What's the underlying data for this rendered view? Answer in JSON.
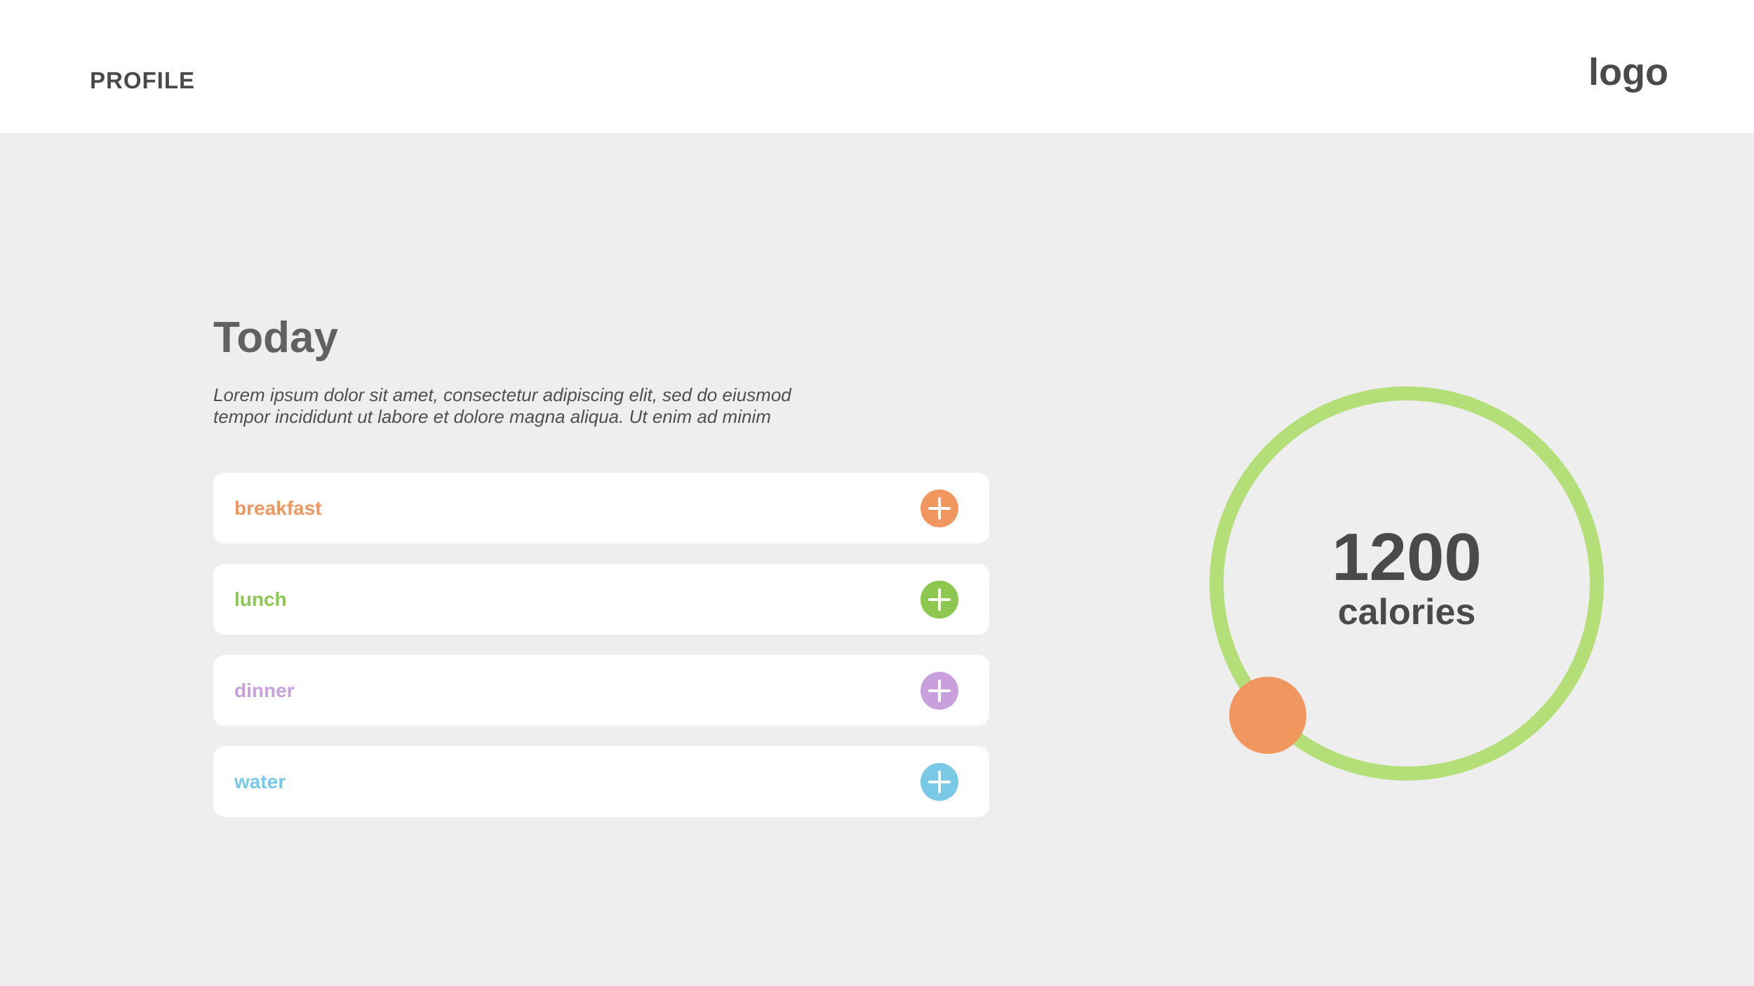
{
  "header": {
    "profile_label": "PROFILE",
    "logo_text": "logo"
  },
  "today": {
    "title": "Today",
    "description_line1": "Lorem ipsum dolor sit amet, consectetur adipiscing elit, sed do eiusmod",
    "description_line2": "tempor incididunt ut labore et dolore magna aliqua. Ut enim ad minim"
  },
  "meals": [
    {
      "label": "breakfast",
      "color": "#f0965f",
      "icon": "plus-icon"
    },
    {
      "label": "lunch",
      "color": "#8cc850",
      "icon": "plus-icon"
    },
    {
      "label": "dinner",
      "color": "#c8a0dc",
      "icon": "plus-icon"
    },
    {
      "label": "water",
      "color": "#78c8e6",
      "icon": "plus-icon"
    }
  ],
  "calories": {
    "value": "1200",
    "unit": "calories",
    "ring_color": "#b4de78",
    "knob_color": "#f0965f"
  }
}
